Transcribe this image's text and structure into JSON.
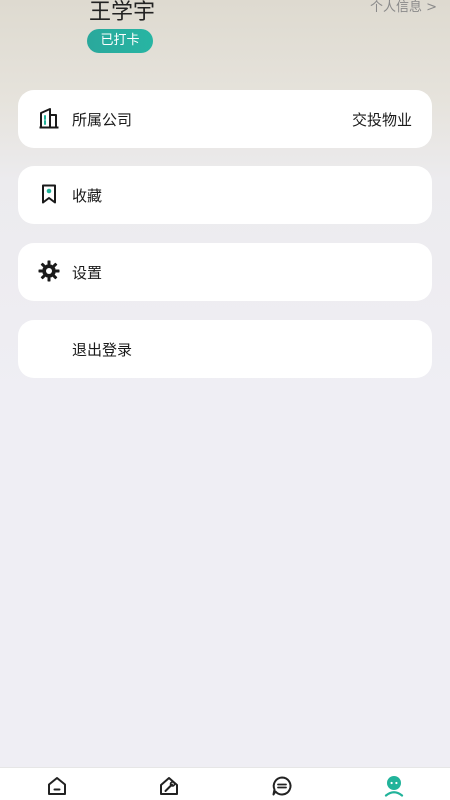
{
  "user": {
    "name": "王学宇",
    "checkin_status": "已打卡",
    "profile_link": "个人信息 >"
  },
  "menu": [
    {
      "label": "所属公司",
      "value": "交投物业",
      "icon": "building-icon"
    },
    {
      "label": "收藏",
      "icon": "bookmark-icon"
    },
    {
      "label": "设置",
      "icon": "gear-icon"
    },
    {
      "label": "退出登录"
    }
  ],
  "tabbar": {
    "tabs": [
      {
        "icon": "home-icon",
        "active": false
      },
      {
        "icon": "tools-icon",
        "active": false
      },
      {
        "icon": "message-icon",
        "active": false
      },
      {
        "icon": "profile-icon",
        "active": true
      }
    ],
    "active_color": "#21b39a",
    "inactive_color": "#222222"
  }
}
